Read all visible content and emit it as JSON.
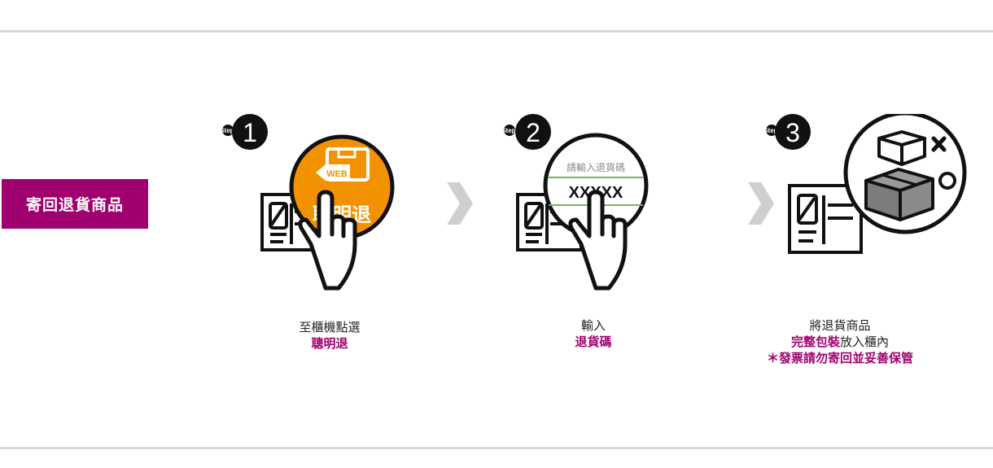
{
  "colors": {
    "brand": "#a0006e",
    "orange": "#f39200",
    "green": "#7ab55c",
    "rule": "#d9d9d9",
    "arrow": "#cfcfcf"
  },
  "label_box": {
    "text": "寄回退貨商品"
  },
  "steps": [
    {
      "badge_prefix": "Step.",
      "number": "1",
      "bubble_tag": "WEB",
      "bubble_text": "聰明退",
      "caption_line1": "至櫃機點選",
      "caption_highlight": "聰明退"
    },
    {
      "badge_prefix": "Step.",
      "number": "2",
      "bubble_prompt": "請輸入退貨碼",
      "bubble_code": "XXXXX",
      "caption_line1": "輸入",
      "caption_highlight": "退貨碼"
    },
    {
      "badge_prefix": "Step.",
      "number": "3",
      "caption_line1": "將退貨商品",
      "caption_highlight": "完整包裝",
      "caption_line2_rest": "放入櫃內",
      "caption_note": "＊發票請勿寄回並妥善保管"
    }
  ],
  "icons": [
    "kiosk-icon",
    "pointing-hand-icon",
    "chevron-right-icon",
    "open-box-icon",
    "closed-box-icon",
    "x-mark-icon",
    "circle-o-icon"
  ]
}
